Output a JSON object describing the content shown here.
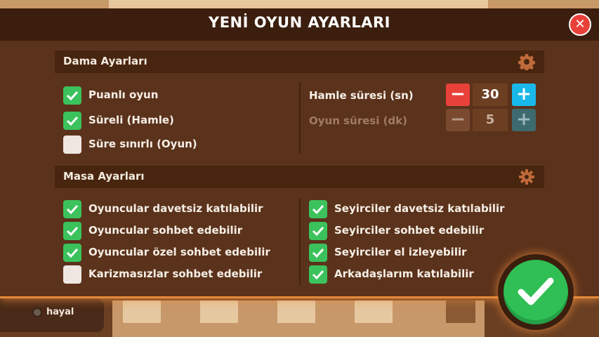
{
  "dialog": {
    "title": "YENİ OYUN AYARLARI",
    "close_label": "✕"
  },
  "game_settings": {
    "title": "Dama Ayarları",
    "icon": "gear-icon",
    "options": [
      {
        "label": "Puanlı oyun",
        "checked": true
      },
      {
        "label": "Süreli (Hamle)",
        "checked": true
      },
      {
        "label": "Süre sınırlı (Oyun)",
        "checked": false
      }
    ],
    "move_time": {
      "label": "Hamle süresi (sn)",
      "value": "30",
      "enabled": true
    },
    "game_time": {
      "label": "Oyun süresi (dk)",
      "value": "5",
      "enabled": false
    },
    "minus_label": "−",
    "plus_label": "+"
  },
  "table_settings": {
    "title": "Masa Ayarları",
    "icon": "cog-icon",
    "left_options": [
      {
        "label": "Oyuncular davetsiz katılabilir",
        "checked": true
      },
      {
        "label": "Oyuncular sohbet edebilir",
        "checked": true
      },
      {
        "label": "Oyuncular özel sohbet edebilir",
        "checked": true
      },
      {
        "label": "Karizmasızlar sohbet edebilir",
        "checked": false
      }
    ],
    "right_options": [
      {
        "label": "Seyirciler davetsiz katılabilir",
        "checked": true
      },
      {
        "label": "Seyirciler sohbet edebilir",
        "checked": true
      },
      {
        "label": "Seyirciler el izleyebilir",
        "checked": true
      },
      {
        "label": "Arkadaşlarım katılabilir",
        "checked": true
      }
    ]
  },
  "background": {
    "player_name": "hayal"
  },
  "colors": {
    "accent_orange": "#e48a3a",
    "check_green": "#3cc25c",
    "minus_red": "#e8413a",
    "plus_cyan": "#19b8ea",
    "panel_brown": "#5b321b"
  }
}
